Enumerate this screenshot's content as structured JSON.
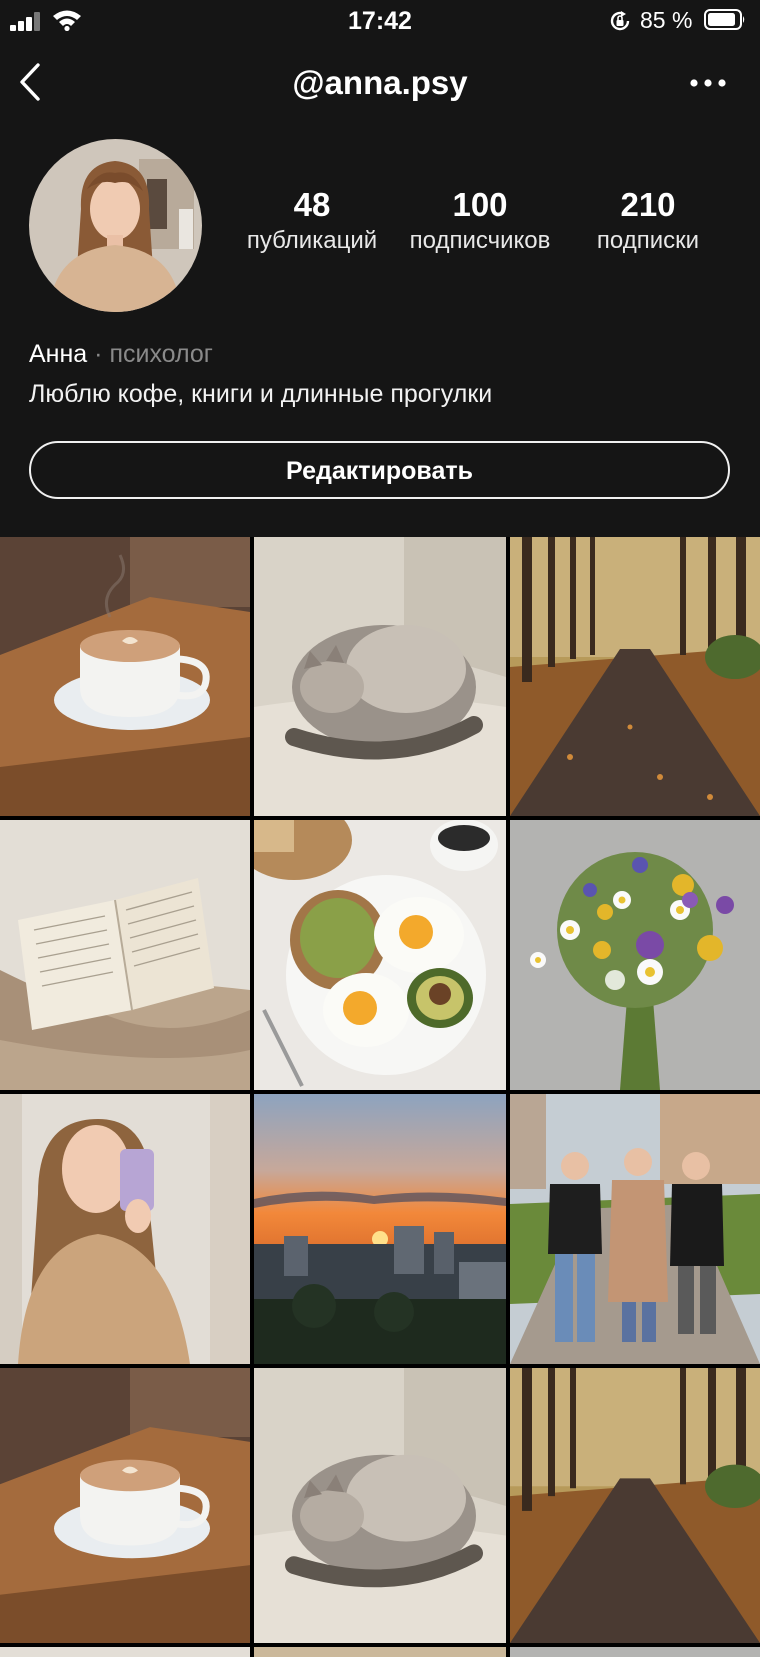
{
  "status_bar": {
    "time": "17:42",
    "battery_percent": "85 %"
  },
  "header": {
    "title": "@anna.psy"
  },
  "stats": [
    {
      "value": "48",
      "label": "публикаций"
    },
    {
      "value": "100",
      "label": "подписчиков"
    },
    {
      "value": "210",
      "label": "подписки"
    }
  ],
  "profile": {
    "name": "Анна",
    "separator": "·",
    "role": "психолог",
    "bio": "Люблю кофе, книги и длинные прогулки"
  },
  "edit_button": {
    "label": "Редактировать"
  },
  "posts": [
    {
      "subject": "coffee-cup"
    },
    {
      "subject": "sleeping-cat"
    },
    {
      "subject": "autumn-park-path"
    },
    {
      "subject": "open-book-on-blanket"
    },
    {
      "subject": "breakfast-plate"
    },
    {
      "subject": "wildflower-bouquet"
    },
    {
      "subject": "mirror-selfie"
    },
    {
      "subject": "city-sunset"
    },
    {
      "subject": "friends-walking"
    },
    {
      "subject": "coffee-cup"
    },
    {
      "subject": "sleeping-cat"
    },
    {
      "subject": "autumn-park-path"
    }
  ]
}
